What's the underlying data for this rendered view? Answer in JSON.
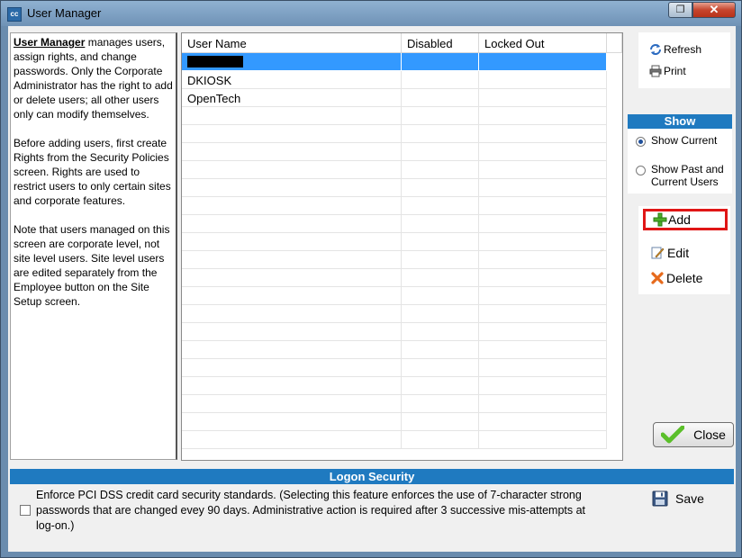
{
  "window": {
    "title": "User Manager",
    "app_icon_label": "cc",
    "restore_glyph": "❐",
    "close_glyph": "✕"
  },
  "help": {
    "title": "User Manager",
    "p1_rest": " manages users, assign rights, and change passwords.  Only the Corporate Administrator has the right to add or delete users; all other users only can modify themselves.",
    "p2": "Before adding users, first create Rights from the Security Policies screen.  Rights are used to restrict users to only certain sites and corporate features.",
    "p3": "Note that users managed on this screen are corporate level, not site level users. Site level users are edited separately from the Employee button on the Site Setup screen."
  },
  "grid": {
    "columns": [
      "User Name",
      "Disabled",
      "Locked Out"
    ],
    "rows": [
      {
        "user_name": "",
        "disabled": "",
        "locked_out": "",
        "redacted": true,
        "selected": true
      },
      {
        "user_name": "DKIOSK",
        "disabled": "",
        "locked_out": ""
      },
      {
        "user_name": "OpenTech",
        "disabled": "",
        "locked_out": ""
      }
    ]
  },
  "toolbar": {
    "refresh_label": "Refresh",
    "print_label": "Print"
  },
  "show": {
    "header": "Show",
    "option_current": "Show Current",
    "option_past_line1": "Show Past and",
    "option_past_line2": "Current Users",
    "selected": "current"
  },
  "actions": {
    "add_label": "Add",
    "edit_label": "Edit",
    "delete_label": "Delete",
    "close_label": "Close"
  },
  "logon": {
    "header": "Logon Security",
    "pci_text": "Enforce PCI DSS credit card security standards.  (Selecting this feature enforces the use of 7-character strong passwords that are changed evey 90 days.  Administrative action is required after 3 successive mis-attempts at log-on.)",
    "pci_checked": false,
    "save_label": "Save"
  },
  "colors": {
    "accent_blue": "#1f7ac0",
    "selection": "#3399ff",
    "highlight_red": "#e01616"
  }
}
